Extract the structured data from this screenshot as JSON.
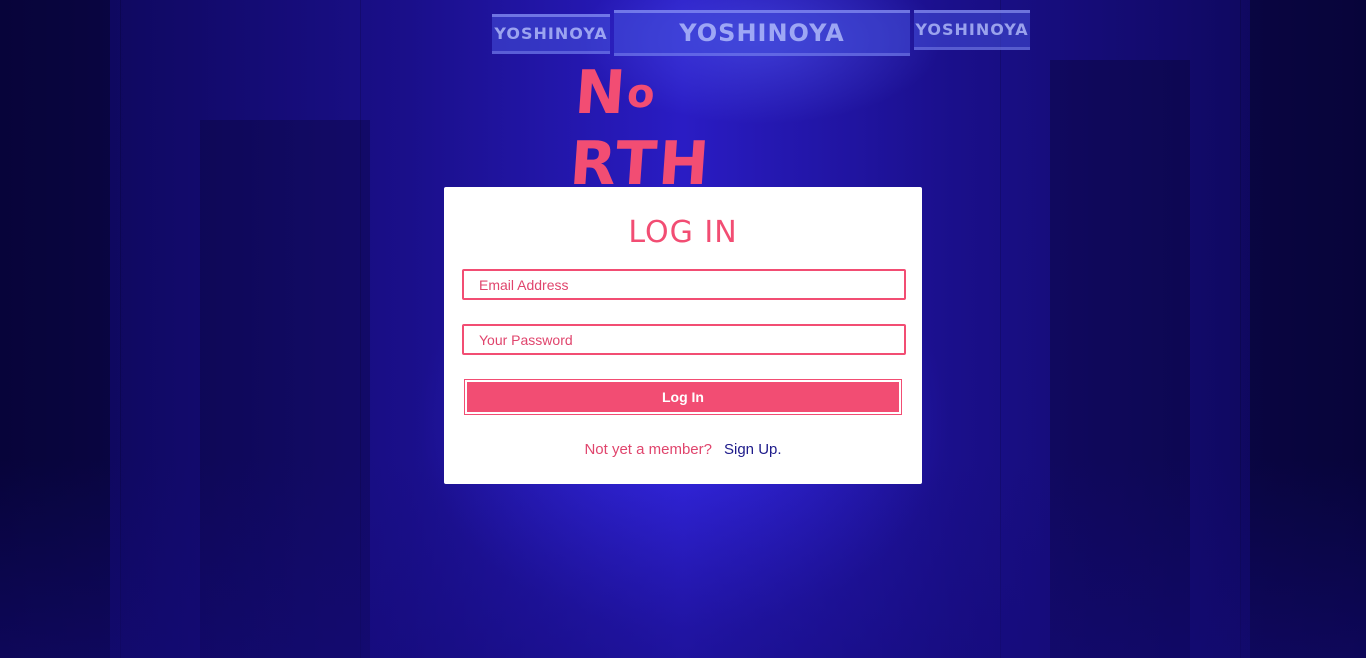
{
  "background": {
    "signs": [
      "YOSHINOYA",
      "YOSHINOYA",
      "YOSHINOYA"
    ]
  },
  "brand": {
    "logo_text_first": "N",
    "logo_text_o": "o",
    "logo_text_rest": "RTH"
  },
  "login_form": {
    "title": "LOG IN",
    "email": {
      "value": "",
      "placeholder": "Email Address"
    },
    "password": {
      "value": "",
      "placeholder": "Your Password"
    },
    "submit_label": "Log In",
    "signup_prompt": "Not yet a member?",
    "signup_link": "Sign Up."
  },
  "colors": {
    "accent": "#f24d73",
    "link": "#1d1a8a",
    "background": "#10086a",
    "card": "#ffffff"
  }
}
